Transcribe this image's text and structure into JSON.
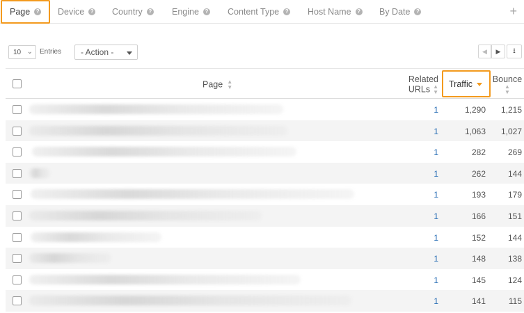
{
  "tabs": [
    {
      "label": "Page",
      "active": true
    },
    {
      "label": "Device"
    },
    {
      "label": "Country"
    },
    {
      "label": "Engine"
    },
    {
      "label": "Content Type"
    },
    {
      "label": "Host Name"
    },
    {
      "label": "By Date"
    }
  ],
  "controls": {
    "entries_value": "10",
    "entries_label": "Entries",
    "action_value": "- Action -"
  },
  "table": {
    "columns": {
      "page": "Page",
      "related_line1": "Related",
      "related_line2": "URLs",
      "traffic": "Traffic",
      "bounce": "Bounce"
    },
    "rows": [
      {
        "related": "1",
        "traffic": "1,290",
        "bounce": "1,215"
      },
      {
        "related": "1",
        "traffic": "1,063",
        "bounce": "1,027"
      },
      {
        "related": "1",
        "traffic": "282",
        "bounce": "269"
      },
      {
        "related": "1",
        "traffic": "262",
        "bounce": "144"
      },
      {
        "related": "1",
        "traffic": "193",
        "bounce": "179"
      },
      {
        "related": "1",
        "traffic": "166",
        "bounce": "151"
      },
      {
        "related": "1",
        "traffic": "152",
        "bounce": "144"
      },
      {
        "related": "1",
        "traffic": "148",
        "bounce": "138"
      },
      {
        "related": "1",
        "traffic": "145",
        "bounce": "124"
      },
      {
        "related": "1",
        "traffic": "141",
        "bounce": "115"
      }
    ]
  },
  "colors": {
    "highlight": "#f39a1e",
    "link": "#2a6fb5"
  },
  "icons": {
    "help": "question-circle-icon",
    "add": "plus-icon",
    "sort": "sort-icon",
    "download": "download-icon"
  }
}
